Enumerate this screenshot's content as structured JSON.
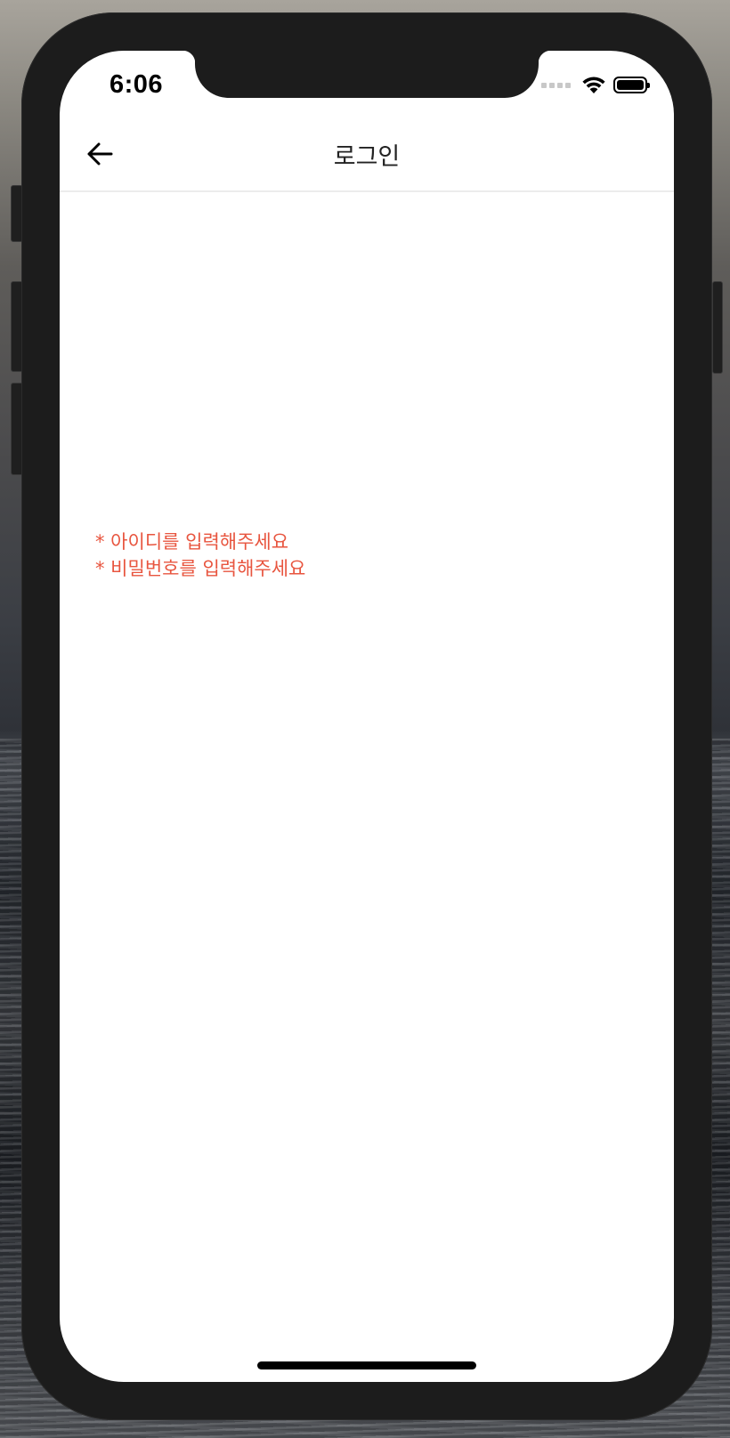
{
  "status_bar": {
    "time": "6:06",
    "icons": [
      "cellular-signal-icon",
      "wifi-icon",
      "battery-icon"
    ]
  },
  "nav_bar": {
    "back_icon": "arrow-left-icon",
    "title": "로그인"
  },
  "validation": {
    "id_error": "* 아이디를 입력해주세요",
    "password_error": "* 비밀번호를 입력해주세요"
  },
  "colors": {
    "error": "#e8553f",
    "title_text": "#222222",
    "device_frame": "#1c1c1c"
  }
}
